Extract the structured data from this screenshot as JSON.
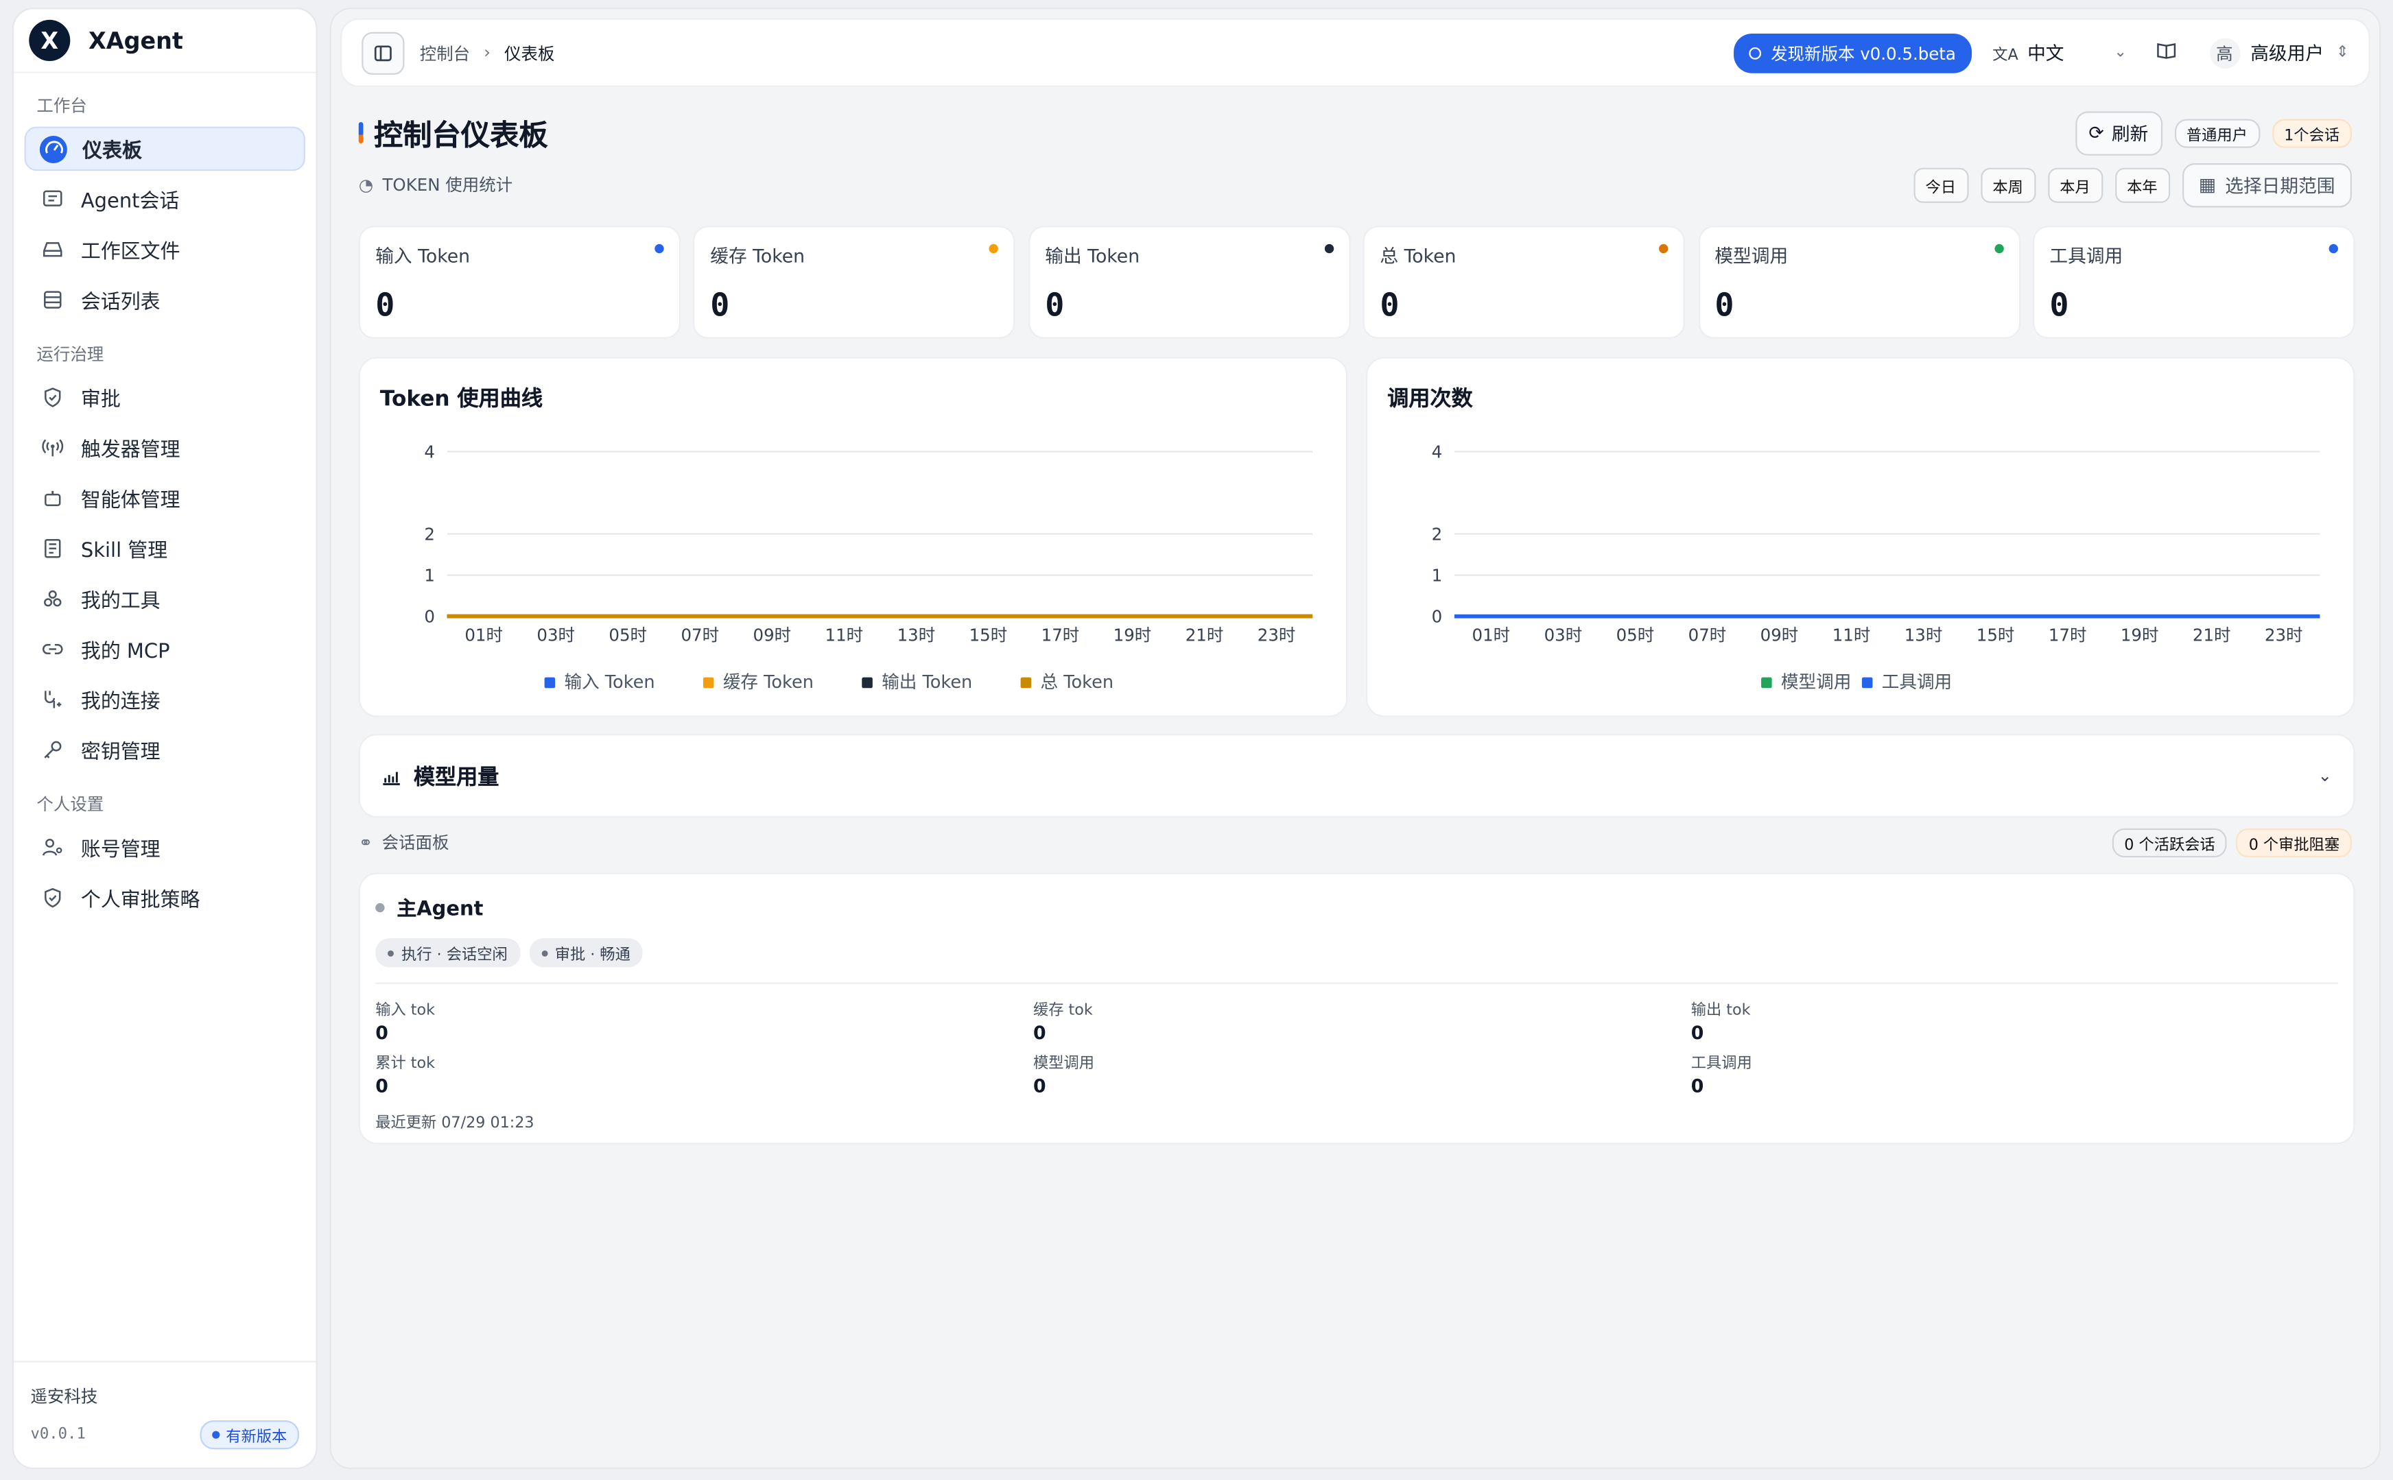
{
  "app": {
    "name": "XAgent",
    "logo_letter": "X"
  },
  "sidebar": {
    "groups": [
      {
        "title": "工作台",
        "items": [
          {
            "label": "仪表板",
            "icon": "gauge-icon",
            "active": true
          },
          {
            "label": "Agent会话",
            "icon": "chat-icon"
          },
          {
            "label": "工作区文件",
            "icon": "drive-icon"
          },
          {
            "label": "会话列表",
            "icon": "list-icon"
          }
        ]
      },
      {
        "title": "运行治理",
        "items": [
          {
            "label": "审批",
            "icon": "shield-icon"
          },
          {
            "label": "触发器管理",
            "icon": "antenna-icon"
          },
          {
            "label": "智能体管理",
            "icon": "bot-icon"
          },
          {
            "label": "Skill 管理",
            "icon": "book-icon"
          },
          {
            "label": "我的工具",
            "icon": "tools-icon"
          },
          {
            "label": "我的 MCP",
            "icon": "link-icon"
          },
          {
            "label": "我的连接",
            "icon": "connection-icon"
          },
          {
            "label": "密钥管理",
            "icon": "key-icon"
          }
        ]
      },
      {
        "title": "个人设置",
        "items": [
          {
            "label": "账号管理",
            "icon": "user-gear-icon"
          },
          {
            "label": "个人审批策略",
            "icon": "shield-check-icon"
          }
        ]
      }
    ],
    "footer": {
      "company": "遥安科技",
      "version": "v0.0.1",
      "new_version": "有新版本"
    }
  },
  "topbar": {
    "breadcrumb": [
      "控制台",
      "仪表板"
    ],
    "update_label": "发现新版本 v0.0.5.beta",
    "language": "中文",
    "user_avatar": "高",
    "user_name": "高级用户"
  },
  "header": {
    "title": "控制台仪表板",
    "refresh_label": "刷新",
    "role_chip": "普通用户",
    "session_chip": "1个会话"
  },
  "token_section": {
    "title": "TOKEN 使用统计",
    "ranges": [
      "今日",
      "本周",
      "本月",
      "本年"
    ],
    "date_picker": "选择日期范围"
  },
  "stats": [
    {
      "label": "输入 Token",
      "value": "0",
      "color": "#2563eb"
    },
    {
      "label": "缓存 Token",
      "value": "0",
      "color": "#f59e0b"
    },
    {
      "label": "输出 Token",
      "value": "0",
      "color": "#1f2937"
    },
    {
      "label": "总 Token",
      "value": "0",
      "color": "#d97706"
    },
    {
      "label": "模型调用",
      "value": "0",
      "color": "#22a55b"
    },
    {
      "label": "工具调用",
      "value": "0",
      "color": "#2563eb"
    }
  ],
  "chart_data": [
    {
      "type": "line",
      "title": "Token 使用曲线",
      "categories": [
        "01时",
        "03时",
        "05时",
        "07时",
        "09时",
        "11时",
        "13时",
        "15时",
        "17时",
        "19时",
        "21时",
        "23时"
      ],
      "yticks": [
        "4",
        "2",
        "1",
        "0"
      ],
      "ylim": [
        0,
        4
      ],
      "legend_position": "bottom",
      "series": [
        {
          "name": "输入 Token",
          "color": "#2563eb",
          "values": [
            0,
            0,
            0,
            0,
            0,
            0,
            0,
            0,
            0,
            0,
            0,
            0,
            0,
            0,
            0,
            0,
            0,
            0,
            0,
            0,
            0,
            0,
            0,
            0
          ]
        },
        {
          "name": "缓存 Token",
          "color": "#f59e0b",
          "values": [
            0,
            0,
            0,
            0,
            0,
            0,
            0,
            0,
            0,
            0,
            0,
            0,
            0,
            0,
            0,
            0,
            0,
            0,
            0,
            0,
            0,
            0,
            0,
            0
          ]
        },
        {
          "name": "输出 Token",
          "color": "#1f2937",
          "values": [
            0,
            0,
            0,
            0,
            0,
            0,
            0,
            0,
            0,
            0,
            0,
            0,
            0,
            0,
            0,
            0,
            0,
            0,
            0,
            0,
            0,
            0,
            0,
            0
          ]
        },
        {
          "name": "总 Token",
          "color": "#ca8a04",
          "values": [
            0,
            0,
            0,
            0,
            0,
            0,
            0,
            0,
            0,
            0,
            0,
            0,
            0,
            0,
            0,
            0,
            0,
            0,
            0,
            0,
            0,
            0,
            0,
            0
          ]
        }
      ]
    },
    {
      "type": "line",
      "title": "调用次数",
      "categories": [
        "01时",
        "03时",
        "05时",
        "07时",
        "09时",
        "11时",
        "13时",
        "15时",
        "17时",
        "19时",
        "21时",
        "23时"
      ],
      "yticks": [
        "4",
        "2",
        "1",
        "0"
      ],
      "ylim": [
        0,
        4
      ],
      "legend_position": "bottom",
      "series": [
        {
          "name": "模型调用",
          "color": "#22a55b",
          "values": [
            0,
            0,
            0,
            0,
            0,
            0,
            0,
            0,
            0,
            0,
            0,
            0,
            0,
            0,
            0,
            0,
            0,
            0,
            0,
            0,
            0,
            0,
            0,
            0
          ]
        },
        {
          "name": "工具调用",
          "color": "#2563eb",
          "values": [
            0,
            0,
            0,
            0,
            0,
            0,
            0,
            0,
            0,
            0,
            0,
            0,
            0,
            0,
            0,
            0,
            0,
            0,
            0,
            0,
            0,
            0,
            0,
            0
          ]
        }
      ]
    }
  ],
  "model_usage": {
    "title": "模型用量"
  },
  "sessions": {
    "title": "会话面板",
    "active_chip": "0 个活跃会话",
    "blocked_chip": "0 个审批阻塞",
    "agent": {
      "name": "主Agent",
      "tags": [
        "执行 · 会话空闲",
        "审批 · 畅通"
      ],
      "metrics": [
        {
          "label": "输入 tok",
          "value": "0"
        },
        {
          "label": "缓存 tok",
          "value": "0"
        },
        {
          "label": "输出 tok",
          "value": "0"
        },
        {
          "label": "累计 tok",
          "value": "0"
        },
        {
          "label": "模型调用",
          "value": "0"
        },
        {
          "label": "工具调用",
          "value": "0"
        }
      ],
      "updated": "最近更新 07/29 01:23"
    }
  }
}
